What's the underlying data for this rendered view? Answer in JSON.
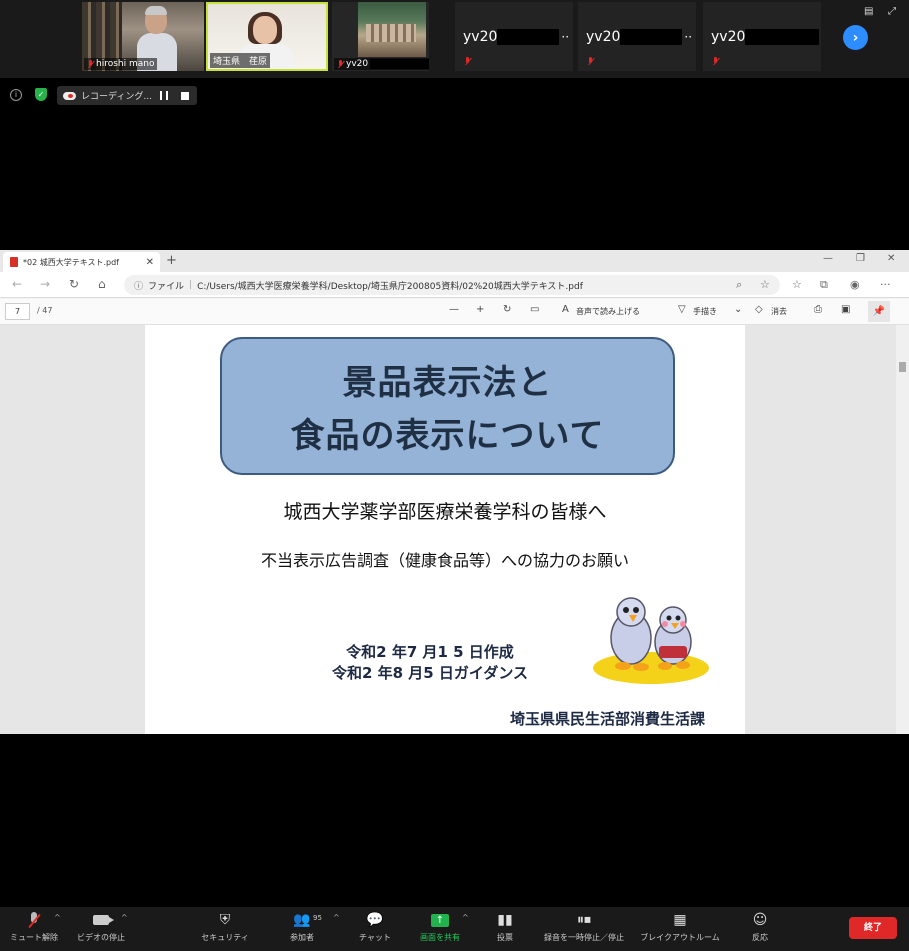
{
  "participants": {
    "tiles": [
      {
        "name": "hiroshi mano"
      },
      {
        "name": "埼玉県　荏原"
      },
      {
        "name": "yv20"
      }
    ],
    "small_tiles": [
      {
        "name": "yv20",
        "more": "··"
      },
      {
        "name": "yv20",
        "more": "··"
      },
      {
        "name": "yv20",
        "more": ""
      }
    ],
    "next_icon": "chevron-right-icon"
  },
  "status": {
    "recording_label": "レコーディング..."
  },
  "browser": {
    "tab_title": "*02 城西大学テキスト.pdf",
    "address_prefix": "ファイル",
    "address": "C:/Users/城西大学医療栄養学科/Desktop/埼玉県庁200805資料/02%20城西大学テキスト.pdf",
    "page_current": "7",
    "page_total": "/ 47",
    "read_aloud": "音声で読み上げる",
    "draw": "手描き",
    "erase": "消去"
  },
  "slide": {
    "title_line1": "景品表示法と",
    "title_line2": "食品の表示について",
    "subtitle1": "城西大学薬学部医療栄養学科の皆様へ",
    "subtitle2": "不当表示広告調査（健康食品等）への協力のお願い",
    "date1": "令和2 年7 月1 5 日作成",
    "date2": "令和2 年8 月5 日ガイダンス",
    "department": "埼玉県県民生活部消費生活課"
  },
  "toolbar": {
    "mute": "ミュート解除",
    "video": "ビデオの停止",
    "security": "セキュリティ",
    "participants": "参加者",
    "participant_count": "95",
    "chat": "チャット",
    "share": "画面を共有",
    "poll": "投票",
    "record": "録音を一時停止／停止",
    "breakout": "ブレイクアウトルーム",
    "reactions": "反応",
    "end": "終了"
  },
  "colors": {
    "title_box": "#95b3d7",
    "share_green": "#23b34e",
    "end_red": "#e02828",
    "active_speaker": "#c7e03a"
  }
}
